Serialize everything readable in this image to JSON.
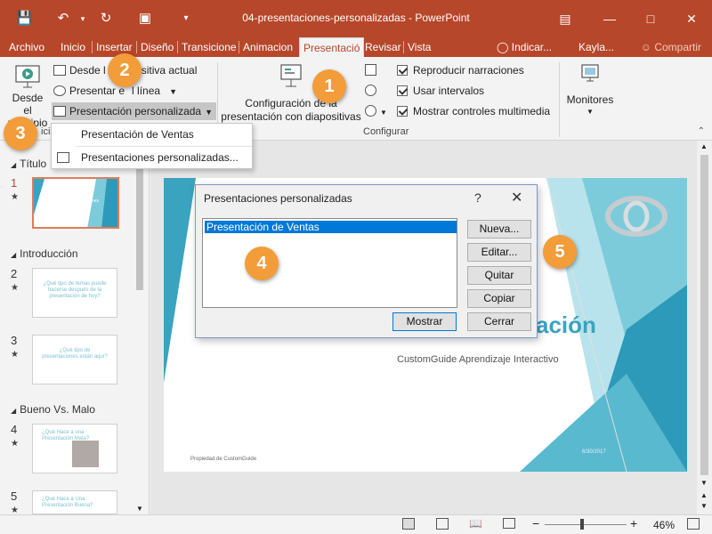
{
  "window": {
    "title": "04-presentaciones-personalizadas  -  PowerPoint"
  },
  "tabs": {
    "archivo": "Archivo",
    "items": [
      "Inicio",
      "Insertar",
      "Diseño",
      "Transicione",
      "Animacion",
      "Presentació",
      "Revisar",
      "Vista"
    ],
    "active": "Presentació",
    "tell_me": "Indicar...",
    "user": "Kayla...",
    "share": "Compartir"
  },
  "ribbon": {
    "desde_el_principio": [
      "Desde el",
      "principio"
    ],
    "desde_diapositiva_actual": "Desde la diapositiva actual",
    "desde_diapositiva_visible": "Desde l",
    "desde_diapositiva_visible_tail": "sitiva actual",
    "presentar_en_linea": "Presentar en línea",
    "presentar_en_linea_visible_a": "Presentar e",
    "presentar_en_linea_visible_b": "l línea",
    "presentacion_personalizada": "Presentación personalizada",
    "configuracion": [
      "Configuración de la",
      "presentación con diapositivas"
    ],
    "reproducir_narraciones": "Reproducir narraciones",
    "usar_intervalos": "Usar intervalos",
    "mostrar_controles": "Mostrar controles multimedia",
    "monitores": "Monitores",
    "group_configurar": "Configurar",
    "group_iniciar_partial": "iciar"
  },
  "dropdown": {
    "items": [
      "Presentación de Ventas",
      "Presentaciones personalizadas..."
    ]
  },
  "thumbnails": {
    "sections": [
      "Título",
      "Introducción",
      "Bueno Vs. Malo"
    ],
    "slides": [
      {
        "num": "1",
        "text": "Qué es Presentaciones Personalizadas"
      },
      {
        "num": "2",
        "text": "¿Qué tipo de temas puede hacerse después de la presentación de hoy?"
      },
      {
        "num": "3",
        "text": "¿Qué tipo de presentaciones están aquí?"
      },
      {
        "num": "4",
        "text": "¿Qué Hace a una Presentación Mala?"
      },
      {
        "num": "5",
        "text": "¿Qué Hace a Una Presentación Buena?"
      }
    ]
  },
  "slide": {
    "title_partial": "ación",
    "subtitle": "CustomGuide Aprendizaje Interactivo",
    "footer_left": "Propiedad de CustomGuide",
    "footer_right": "6/30/2017"
  },
  "dialog": {
    "title": "Presentaciones personalizadas",
    "help": "?",
    "close": "✕",
    "list_items": [
      "Presentación de Ventas"
    ],
    "buttons": {
      "nueva": "Nueva...",
      "editar": "Editar...",
      "quitar": "Quitar",
      "copiar": "Copiar",
      "mostrar": "Mostrar",
      "cerrar": "Cerrar"
    }
  },
  "callouts": [
    "1",
    "2",
    "3",
    "4",
    "5"
  ],
  "statusbar": {
    "zoom": "46%",
    "minus": "−",
    "plus": "+"
  },
  "colors": {
    "accent": "#b7472a",
    "callout": "#f29c3a",
    "selection": "#0078d7",
    "slide_teal": "#4fb3c8"
  }
}
